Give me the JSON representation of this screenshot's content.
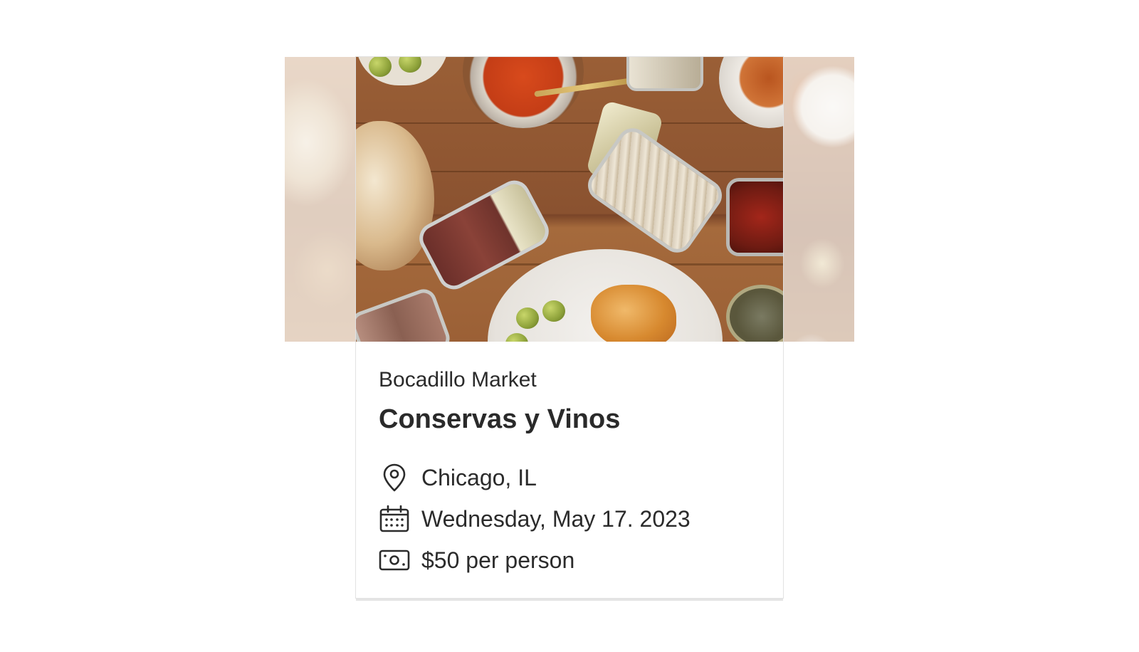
{
  "event": {
    "vendor": "Bocadillo Market",
    "title": "Conservas y Vinos",
    "location": "Chicago, IL",
    "date": "Wednesday, May 17. 2023",
    "price": "$50 per person"
  },
  "icons": {
    "location": "map-pin-icon",
    "date": "calendar-icon",
    "price": "cash-icon"
  },
  "colors": {
    "text": "#2a2a2a",
    "card_border": "#e2e2e2",
    "background": "#ffffff"
  }
}
